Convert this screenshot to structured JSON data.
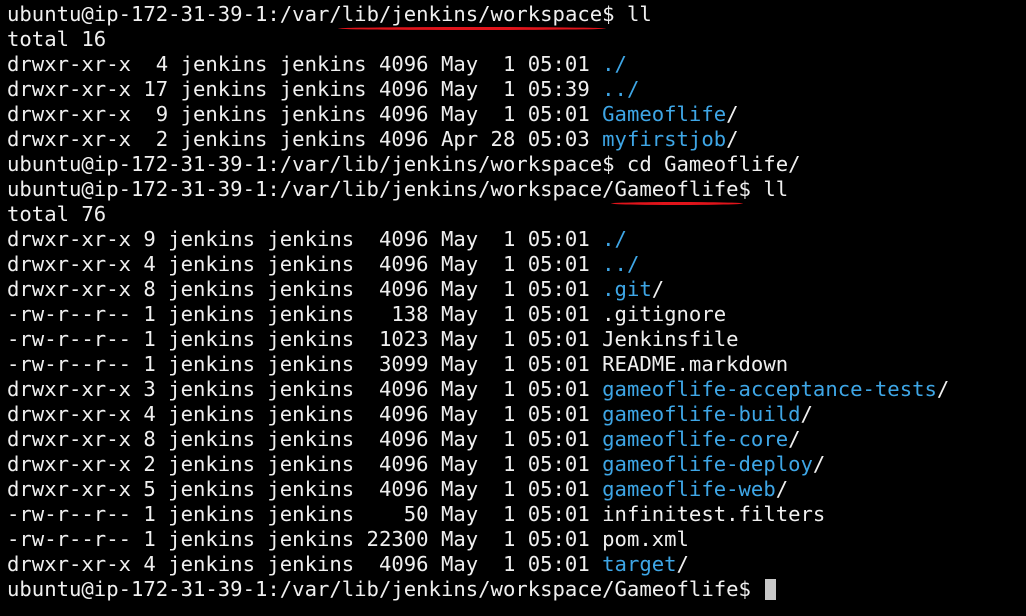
{
  "terminal": {
    "prompt1": {
      "pre": "ubuntu@ip-172-31-39-1:/var/",
      "marked": "lib/jenkins/workspace",
      "post": "$ ll"
    },
    "total1": "total 16",
    "listing1": [
      {
        "meta": "drwxr-xr-x  4 jenkins jenkins 4096 May  1 05:01 ",
        "name": "./",
        "slash": "",
        "dir": true
      },
      {
        "meta": "drwxr-xr-x 17 jenkins jenkins 4096 May  1 05:39 ",
        "name": "../",
        "slash": "",
        "dir": true
      },
      {
        "meta": "drwxr-xr-x  9 jenkins jenkins 4096 May  1 05:01 ",
        "name": "Gameoflife",
        "slash": "/",
        "dir": true
      },
      {
        "meta": "drwxr-xr-x  2 jenkins jenkins 4096 Apr 28 05:03 ",
        "name": "myfirstjob",
        "slash": "/",
        "dir": true
      }
    ],
    "cd_line": "ubuntu@ip-172-31-39-1:/var/lib/jenkins/workspace$ cd Gameoflife/",
    "prompt2": {
      "pre": "ubuntu@ip-172-31-39-1:/var/lib/jenkins/workspace/",
      "marked": "Gameoflife",
      "post": "$ ll"
    },
    "total2": "total 76",
    "listing2": [
      {
        "meta": "drwxr-xr-x 9 jenkins jenkins  4096 May  1 05:01 ",
        "name": "./",
        "slash": "",
        "dir": true
      },
      {
        "meta": "drwxr-xr-x 4 jenkins jenkins  4096 May  1 05:01 ",
        "name": "../",
        "slash": "",
        "dir": true
      },
      {
        "meta": "drwxr-xr-x 8 jenkins jenkins  4096 May  1 05:01 ",
        "name": ".git",
        "slash": "/",
        "dir": true
      },
      {
        "meta": "-rw-r--r-- 1 jenkins jenkins   138 May  1 05:01 ",
        "name": ".gitignore",
        "slash": "",
        "dir": false
      },
      {
        "meta": "-rw-r--r-- 1 jenkins jenkins  1023 May  1 05:01 ",
        "name": "Jenkinsfile",
        "slash": "",
        "dir": false
      },
      {
        "meta": "-rw-r--r-- 1 jenkins jenkins  3099 May  1 05:01 ",
        "name": "README.markdown",
        "slash": "",
        "dir": false
      },
      {
        "meta": "drwxr-xr-x 3 jenkins jenkins  4096 May  1 05:01 ",
        "name": "gameoflife-acceptance-tests",
        "slash": "/",
        "dir": true
      },
      {
        "meta": "drwxr-xr-x 4 jenkins jenkins  4096 May  1 05:01 ",
        "name": "gameoflife-build",
        "slash": "/",
        "dir": true
      },
      {
        "meta": "drwxr-xr-x 8 jenkins jenkins  4096 May  1 05:01 ",
        "name": "gameoflife-core",
        "slash": "/",
        "dir": true
      },
      {
        "meta": "drwxr-xr-x 2 jenkins jenkins  4096 May  1 05:01 ",
        "name": "gameoflife-deploy",
        "slash": "/",
        "dir": true
      },
      {
        "meta": "drwxr-xr-x 5 jenkins jenkins  4096 May  1 05:01 ",
        "name": "gameoflife-web",
        "slash": "/",
        "dir": true
      },
      {
        "meta": "-rw-r--r-- 1 jenkins jenkins    50 May  1 05:01 ",
        "name": "infinitest.filters",
        "slash": "",
        "dir": false
      },
      {
        "meta": "-rw-r--r-- 1 jenkins jenkins 22300 May  1 05:01 ",
        "name": "pom.xml",
        "slash": "",
        "dir": false
      },
      {
        "meta": "drwxr-xr-x 4 jenkins jenkins  4096 May  1 05:01 ",
        "name": "target",
        "slash": "/",
        "dir": true
      }
    ],
    "final_prompt": "ubuntu@ip-172-31-39-1:/var/lib/jenkins/workspace/Gameoflife$ ",
    "colors": {
      "background": "#000000",
      "text": "#f0f0f0",
      "directory": "#3ea6e6",
      "annotation": "#e0141b",
      "cursor": "#c8c8c8"
    }
  }
}
